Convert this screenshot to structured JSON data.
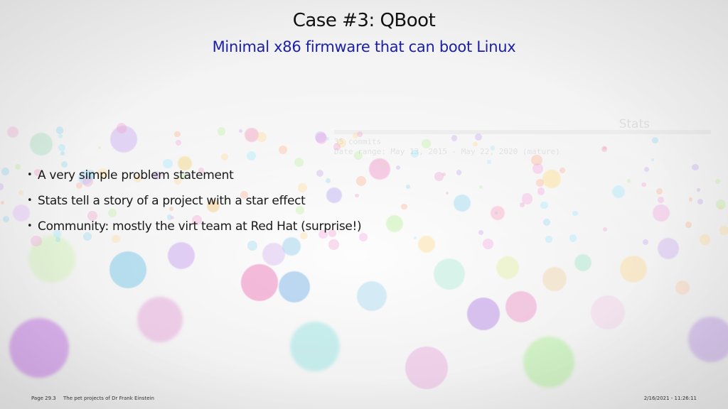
{
  "slide": {
    "title": "Case #3: QBoot",
    "subtitle": "Minimal x86 firmware that can boot Linux",
    "bullets": [
      "A very simple problem statement",
      "Stats tell a story of a project with a star effect",
      "Community: mostly the virt team at Red Hat (surprise!)"
    ]
  },
  "background_ghost": {
    "title": "Stats",
    "line1": "35 commits",
    "line2": "Date range: May 13, 2015 - May 22, 2020 (mature)"
  },
  "footer": {
    "page": "Page 29.3",
    "presentation": "The pet projects of Dr Frank Einstein",
    "datetime": "2/16/2021 - 11:26:11"
  },
  "colors": {
    "title": "#111111",
    "subtitle": "#1a1fa8",
    "text": "#1a1a1a"
  }
}
